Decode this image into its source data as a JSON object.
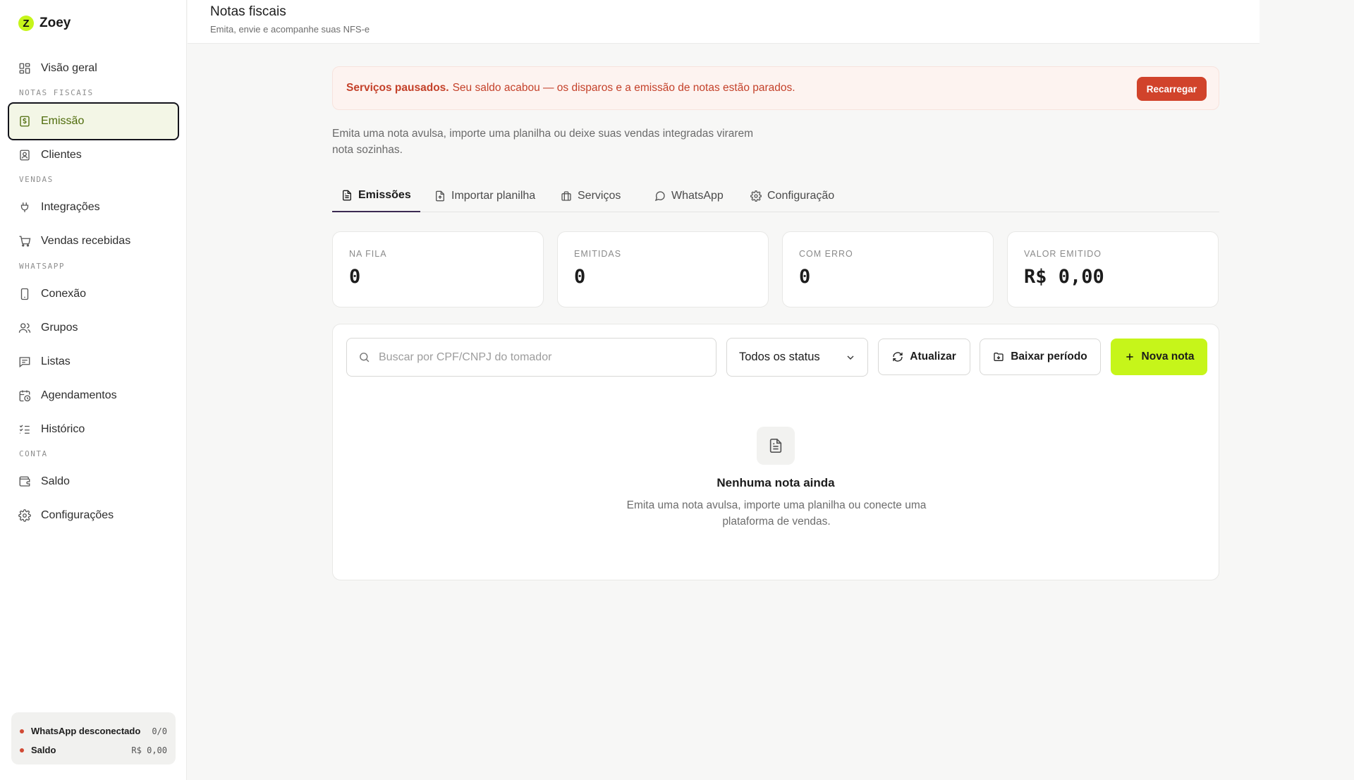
{
  "app": {
    "name": "Zoey"
  },
  "sidebar": {
    "items": [
      {
        "label": "Visão geral"
      },
      {
        "label": "Emissão"
      },
      {
        "label": "Clientes"
      },
      {
        "label": "Integrações"
      },
      {
        "label": "Vendas recebidas"
      },
      {
        "label": "Conexão"
      },
      {
        "label": "Grupos"
      },
      {
        "label": "Listas"
      },
      {
        "label": "Agendamentos"
      },
      {
        "label": "Histórico"
      },
      {
        "label": "Saldo"
      },
      {
        "label": "Configurações"
      }
    ],
    "sections": [
      "NOTAS FISCAIS",
      "VENDAS",
      "WHATSAPP",
      "CONTA"
    ],
    "status": [
      {
        "label": "WhatsApp desconectado",
        "value": "0/0"
      },
      {
        "label": "Saldo",
        "value": "R$ 0,00"
      }
    ]
  },
  "header": {
    "title": "Notas fiscais",
    "subtitle": "Emita, envie e acompanhe suas NFS-e"
  },
  "alert": {
    "strong": "Serviços pausados.",
    "message": "Seu saldo acabou — os disparos e a emissão de notas estão parados.",
    "button": "Recarregar"
  },
  "intro": "Emita uma nota avulsa, importe uma planilha ou deixe suas vendas integradas virarem nota sozinhas.",
  "tabs": [
    {
      "label": "Emissões"
    },
    {
      "label": "Importar planilha"
    },
    {
      "label": "Serviços"
    },
    {
      "label": "WhatsApp"
    },
    {
      "label": "Configuração"
    }
  ],
  "stats": [
    {
      "label": "NA FILA",
      "value": "0"
    },
    {
      "label": "EMITIDAS",
      "value": "0"
    },
    {
      "label": "COM ERRO",
      "value": "0"
    },
    {
      "label": "VALOR EMITIDO",
      "value": "R$ 0,00"
    }
  ],
  "toolbar": {
    "search_placeholder": "Buscar por CPF/CNPJ do tomador",
    "status_filter": "Todos os status",
    "refresh": "Atualizar",
    "download": "Baixar período",
    "new_note": "Nova nota"
  },
  "empty": {
    "title": "Nenhuma nota ainda",
    "description": "Emita uma nota avulsa, importe uma planilha ou conecte uma plataforma de vendas."
  },
  "colors": {
    "accent": "#c6f51a",
    "danger": "#d1432b",
    "active_text": "#4e6b0a"
  }
}
